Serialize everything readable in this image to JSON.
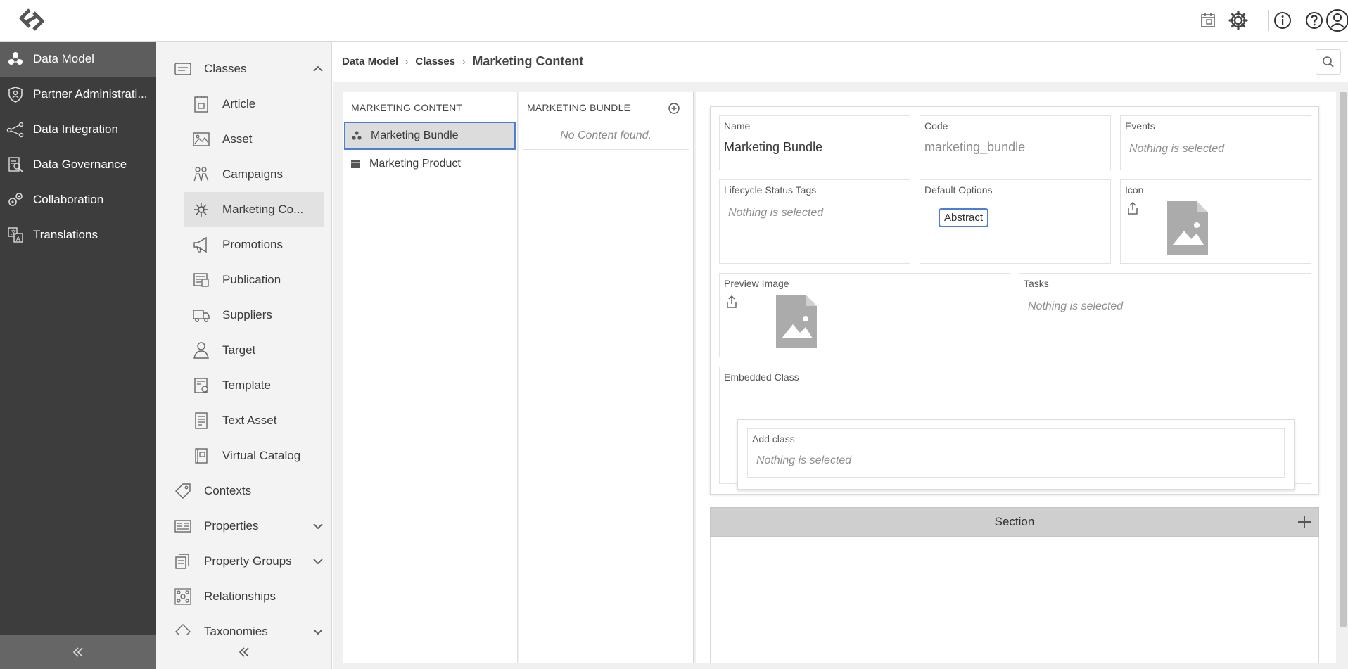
{
  "sidebar": {
    "items": [
      {
        "label": "Data Model",
        "icon": "data-model-icon"
      },
      {
        "label": "Partner Administrati...",
        "icon": "shield-icon"
      },
      {
        "label": "Data Integration",
        "icon": "integration-icon"
      },
      {
        "label": "Data Governance",
        "icon": "governance-icon"
      },
      {
        "label": "Collaboration",
        "icon": "collaboration-icon"
      },
      {
        "label": "Translations",
        "icon": "translations-icon"
      }
    ]
  },
  "subnav": {
    "classes_label": "Classes",
    "children": [
      {
        "label": "Article"
      },
      {
        "label": "Asset"
      },
      {
        "label": "Campaigns"
      },
      {
        "label": "Marketing Co..."
      },
      {
        "label": "Promotions"
      },
      {
        "label": "Publication"
      },
      {
        "label": "Suppliers"
      },
      {
        "label": "Target"
      },
      {
        "label": "Template"
      },
      {
        "label": "Text Asset"
      },
      {
        "label": "Virtual Catalog"
      }
    ],
    "contexts_label": "Contexts",
    "properties_label": "Properties",
    "property_groups_label": "Property Groups",
    "relationships_label": "Relationships",
    "taxonomies_label": "Taxonomies"
  },
  "breadcrumb": {
    "first": "Data Model",
    "second": "Classes",
    "current": "Marketing Content"
  },
  "col1": {
    "header": "MARKETING CONTENT",
    "items": [
      "Marketing Bundle",
      "Marketing Product"
    ]
  },
  "col2": {
    "header": "MARKETING BUNDLE",
    "empty": "No Content found."
  },
  "detail": {
    "name_label": "Name",
    "name_value": "Marketing Bundle",
    "code_label": "Code",
    "code_value": "marketing_bundle",
    "events_label": "Events",
    "lifecycle_label": "Lifecycle Status Tags",
    "default_options_label": "Default Options",
    "default_option_chip": "Abstract",
    "icon_label": "Icon",
    "preview_label": "Preview Image",
    "tasks_label": "Tasks",
    "embedded_label": "Embedded Class",
    "add_class_label": "Add class",
    "nothing_selected": "Nothing is selected",
    "section_label": "Section"
  },
  "colors": {
    "sidebar_bg": "#3d3d3d",
    "sidebar_active": "#5d5d5d",
    "accent_blue": "#4a7fd4",
    "section_bar": "#cfcfcf"
  }
}
